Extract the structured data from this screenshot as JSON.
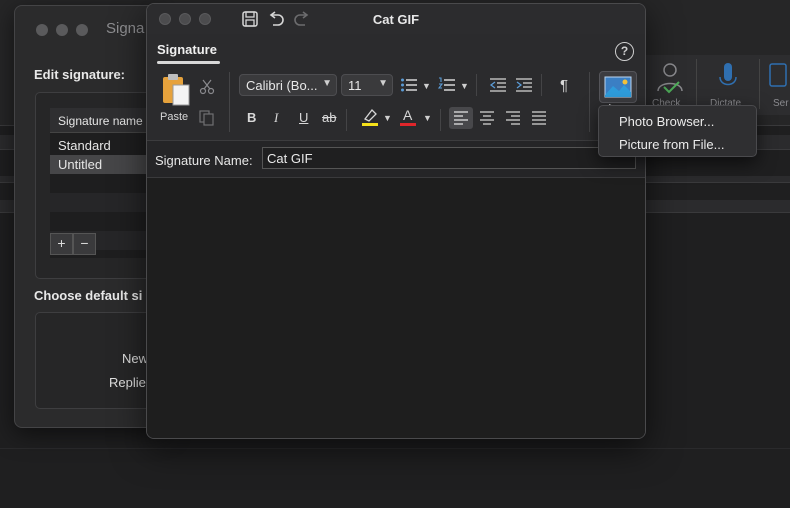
{
  "back_window": {
    "title": "Signa",
    "edit_signature_label": "Edit signature:",
    "list_header": "Signature name",
    "signatures": [
      "Standard",
      "Untitled"
    ],
    "add_label": "+",
    "remove_label": "−",
    "choose_default_label": "Choose default si",
    "new_label": "New",
    "replies_label": "Replie"
  },
  "background_ribbon": {
    "check_label": "Check",
    "dictate_label": "Dictate",
    "send_label": "Ser"
  },
  "main_window": {
    "title": "Cat GIF",
    "tab": "Signature",
    "help_label": "?",
    "paste_label": "Paste",
    "font_name": "Calibri (Bo...",
    "font_size": "11",
    "bold_label": "B",
    "italic_label": "I",
    "underline_label": "U",
    "strike_label": "ab",
    "pilcrow_label": "¶",
    "font_color_label": "A",
    "signature_name_label": "Signature Name:",
    "signature_name_value": "Cat GIF",
    "colors": {
      "highlight": "#f5e11a",
      "font_color": "#e0262b"
    }
  },
  "picture_menu": {
    "items": [
      "Photo Browser...",
      "Picture from File..."
    ]
  }
}
